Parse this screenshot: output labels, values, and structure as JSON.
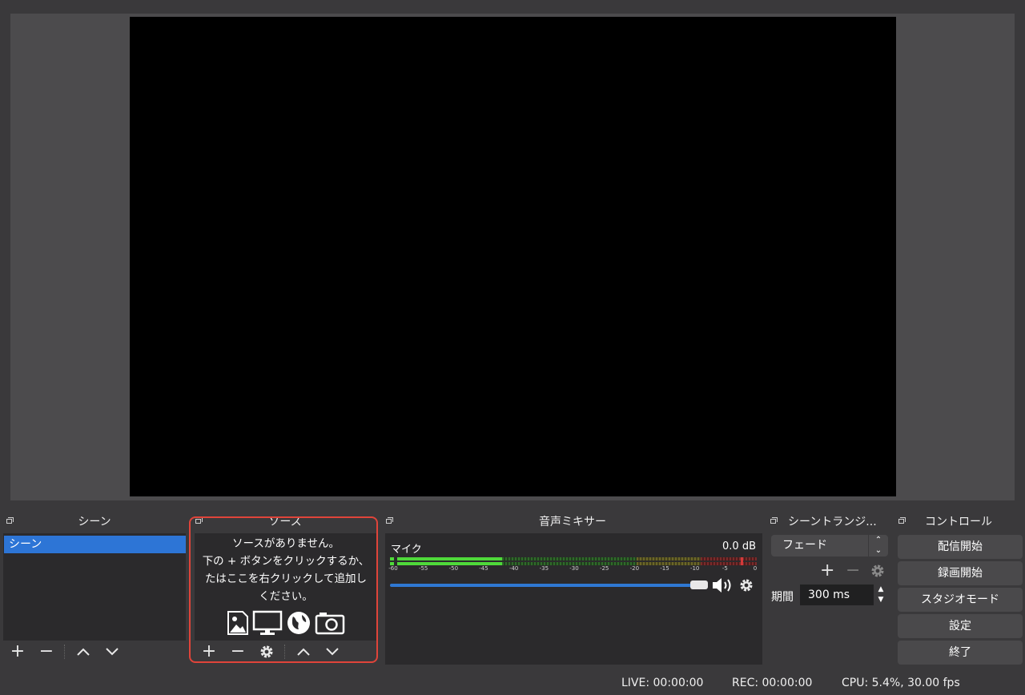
{
  "docks": {
    "scenes_title": "シーン",
    "sources_title": "ソース",
    "mixer_title": "音声ミキサー",
    "transitions_title": "シーントランジ...",
    "controls_title": "コントロール"
  },
  "scenes": {
    "items": [
      "シーン"
    ]
  },
  "sources": {
    "empty_line1": "ソースがありません。",
    "empty_line2": "下の + ボタンをクリックするか、",
    "empty_line3": "たはここを右クリックして追加し",
    "empty_line4": "ください。",
    "source_type_icons": [
      "image-icon",
      "display-capture-icon",
      "browser-globe-icon",
      "camera-icon"
    ]
  },
  "mixer": {
    "channel_name": "マイク",
    "level": "0.0 dB",
    "ticks": [
      "-60",
      "-55",
      "-50",
      "-45",
      "-40",
      "-35",
      "-30",
      "-25",
      "-20",
      "-15",
      "-10",
      "-5",
      "0"
    ],
    "volume_fraction": 1.0
  },
  "transitions": {
    "selected": "フェード",
    "duration_label": "期間",
    "duration_value": "300 ms"
  },
  "controls": {
    "start_streaming": "配信開始",
    "start_recording": "録画開始",
    "studio_mode": "スタジオモード",
    "settings": "設定",
    "exit": "終了"
  },
  "status": {
    "live": "LIVE: 00:00:00",
    "rec": "REC: 00:00:00",
    "cpu": "CPU: 5.4%, 30.00 fps"
  },
  "colors": {
    "selection": "#2d75d6",
    "highlight_border": "#e0443a",
    "meter_green": "#4fd93a",
    "meter_yellow": "#c9c23a",
    "meter_red": "#d43a3a"
  }
}
